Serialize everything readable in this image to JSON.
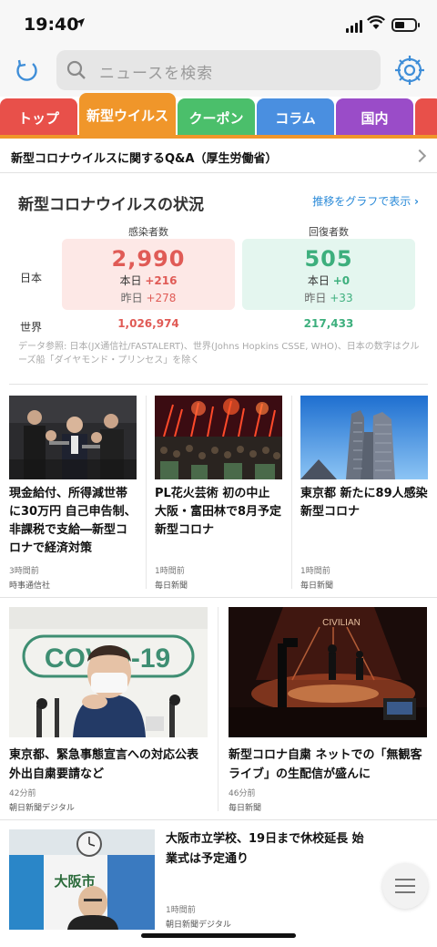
{
  "status_bar": {
    "time": "19:40",
    "location_icon": "navigation-arrow-icon",
    "signal_icon": "cellular-signal-icon",
    "wifi_icon": "wifi-icon",
    "battery_icon": "battery-icon"
  },
  "header": {
    "refresh_icon": "refresh-icon",
    "search_placeholder": "ニュースを検索",
    "search_icon": "search-icon",
    "settings_icon": "gear-icon"
  },
  "tabs": [
    {
      "label": "トップ",
      "color": "#e8504a"
    },
    {
      "label": "新型ウイルス",
      "color": "#f0962a",
      "active": true
    },
    {
      "label": "クーポン",
      "color": "#4bbf6b"
    },
    {
      "label": "コラム",
      "color": "#4a8fe0"
    },
    {
      "label": "国内",
      "color": "#9a4cc8"
    }
  ],
  "qa_banner": {
    "text": "新型コロナウイルスに関するQ&A（厚生労働省）"
  },
  "covid": {
    "title": "新型コロナウイルスの状況",
    "graph_link": "推移をグラフで表示",
    "infected_header": "感染者数",
    "recovered_header": "回復者数",
    "japan_label": "日本",
    "world_label": "世界",
    "japan_infected": "2,990",
    "japan_infected_today_label": "本日",
    "japan_infected_today": "+216",
    "japan_infected_yesterday_label": "昨日",
    "japan_infected_yesterday": "+278",
    "japan_recovered": "505",
    "japan_recovered_today_label": "本日",
    "japan_recovered_today": "+0",
    "japan_recovered_yesterday_label": "昨日",
    "japan_recovered_yesterday": "+33",
    "world_infected": "1,026,974",
    "world_recovered": "217,433",
    "note": "データ参照: 日本(JX通信社/FASTALERT)、世界(Johns Hopkins CSSE, WHO)、日本の数字はクルーズ船「ダイヤモンド・プリンセス」を除く",
    "colors": {
      "infected": "#e05b56",
      "recovered": "#3daf7d"
    }
  },
  "news_row1": [
    {
      "headline": "現金給付、所得減世帯に30万円 自己申告制、非課税で支給―新型コロナで経済対策",
      "ago": "3時間前",
      "source": "時事通信社"
    },
    {
      "headline": "PL花火芸術 初の中止 大阪・富田林で8月予定 新型コロナ",
      "ago": "1時間前",
      "source": "毎日新聞"
    },
    {
      "headline": "東京都 新たに89人感染 新型コロナ",
      "ago": "1時間前",
      "source": "毎日新聞"
    }
  ],
  "news_row2": [
    {
      "headline": "東京都、緊急事態宣言への対応公表 外出自粛要請など",
      "ago": "42分前",
      "source": "朝日新聞デジタル",
      "image_text": "COVID-19"
    },
    {
      "headline": "新型コロナ自粛 ネットでの「無観客ライブ」の生配信が盛んに",
      "ago": "46分前",
      "source": "毎日新聞",
      "image_text": "CIVILIAN"
    }
  ],
  "news_row3": {
    "headline": "大阪市立学校、19日まで休校延長 始業式は予定通り",
    "ago": "1時間前",
    "source": "朝日新聞デジタル",
    "image_text": "大阪市"
  },
  "menu_icon": "hamburger-menu-icon"
}
